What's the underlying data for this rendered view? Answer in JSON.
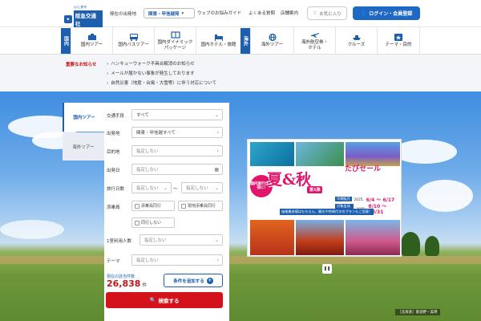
{
  "header": {
    "logo_tagline": "心に旅を",
    "logo_name": "阪急交通社",
    "logo_sub": "Hankyu Travel",
    "departure_label": "発在の出発地",
    "departure_value": "関東・甲信越発",
    "links": [
      "ウェブのお悩みガイド",
      "よくある質問",
      "店舗案内"
    ],
    "favorites_label": "お気に入り",
    "login_label": "ログイン・会員登録"
  },
  "nav": {
    "domestic_tag": "国内",
    "overseas_tag": "海外",
    "items": [
      {
        "label": "国内ツアー",
        "icon": "tour-icon"
      },
      {
        "label": "国内バスツアー",
        "icon": "bus-icon"
      },
      {
        "label": "国内ダイナミック\nパッケージ",
        "icon": "package-icon"
      },
      {
        "label": "国内ホテル・旅館",
        "icon": "hotel-icon"
      },
      {
        "label": "海外ツアー",
        "icon": "globe-icon"
      },
      {
        "label": "海外航空券・\nホテル",
        "icon": "plane-icon"
      },
      {
        "label": "クルーズ",
        "icon": "cruise-icon"
      },
      {
        "label": "テーマ・目的",
        "icon": "theme-icon"
      }
    ]
  },
  "news": {
    "header": "重要なお知らせ",
    "items": [
      "ハンキューウォーク不具合解消のお知らせ",
      "メールが届かない事象が発生しております",
      "自然災害（地震・台風・大雪等）に伴う対応について"
    ]
  },
  "search": {
    "tabs": [
      "国内ツアー",
      "海外ツアー"
    ],
    "fields": {
      "transport_label": "交通手段",
      "transport_value": "すべて",
      "departure_label": "出発地",
      "departure_value": "関東・甲信越すべて",
      "destination_label": "目的地",
      "destination_value": "指定しない",
      "date_label": "出発日",
      "date_value": "指定しない",
      "days_label": "旅行日数",
      "days_from": "指定しない",
      "days_sep": "〜",
      "days_to": "指定しない",
      "companion_label": "添乗員",
      "companion_options": [
        "添乗員同行",
        "現地添乗員同行",
        "同行しない"
      ],
      "room_label": "1室利用人数",
      "room_value": "指定しない",
      "theme_label": "テーマ",
      "theme_value": "指定しない"
    },
    "result_label": "現在の該当件数",
    "result_count": "26,838",
    "result_unit": "件",
    "add_condition": "条件を追加する",
    "search_button": "検索する"
  },
  "banner": {
    "round_badge": "国内旅行がお得に!",
    "title": "夏&秋",
    "title_sub": "たびセール",
    "badge": "第1弾",
    "period1_label": "早期販売",
    "period1_year": "2025.",
    "period1_dates": "6/4 〜 6/17",
    "period2_label": "対象出発日",
    "period2_year": "2025.",
    "period2_dates": "8/10 〜 10/31",
    "note": "価格最安値はもちろん、観光や特典付きのプランもご用意！"
  },
  "hero_caption": "［北海道］富良野・美瑛",
  "colors": {
    "brand": "#1d5fae",
    "accent": "#d3121b",
    "sale": "#e0156b"
  }
}
